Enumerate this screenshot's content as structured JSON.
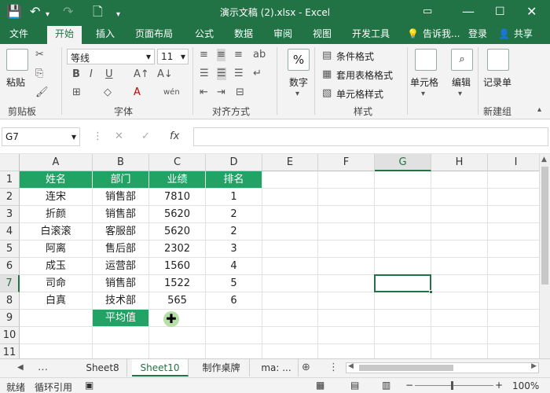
{
  "titlebar": {
    "title": "演示文稿 (2).xlsx - Excel"
  },
  "tabs": {
    "file": "文件",
    "home": "开始",
    "insert": "插入",
    "layout": "页面布局",
    "formula": "公式",
    "data": "数据",
    "review": "审阅",
    "view": "视图",
    "developer": "开发工具",
    "tellme": "告诉我...",
    "login": "登录",
    "share": "共享"
  },
  "ribbon": {
    "paste": "粘贴",
    "clipboard": "剪贴板",
    "font_name": "等线",
    "font_size": "11",
    "font_group": "字体",
    "align_group": "对齐方式",
    "number": "数字",
    "cond_format": "条件格式",
    "table_format": "套用表格格式",
    "cell_style": "单元格样式",
    "style_group": "样式",
    "cells": "单元格",
    "edit": "编辑",
    "record": "记录单",
    "new_group": "新建组"
  },
  "formula_bar": {
    "name_box": "G7",
    "fx": "fx",
    "value": ""
  },
  "columns": [
    "A",
    "B",
    "C",
    "D",
    "E",
    "F",
    "G",
    "H",
    "I"
  ],
  "rows": [
    "1",
    "2",
    "3",
    "4",
    "5",
    "6",
    "7",
    "8",
    "9",
    "10",
    "11"
  ],
  "table": {
    "header": [
      "姓名",
      "部门",
      "业绩",
      "排名"
    ],
    "rows": [
      [
        "连宋",
        "销售部",
        "7810",
        "1"
      ],
      [
        "折颜",
        "销售部",
        "5620",
        "2"
      ],
      [
        "白滚滚",
        "客服部",
        "5620",
        "2"
      ],
      [
        "阿离",
        "售后部",
        "2302",
        "3"
      ],
      [
        "成玉",
        "运营部",
        "1560",
        "4"
      ],
      [
        "司命",
        "销售部",
        "1522",
        "5"
      ],
      [
        "白真",
        "技术部",
        "565",
        "6"
      ]
    ],
    "avg_label": "平均值"
  },
  "sheets": {
    "tabs": [
      "Sheet8",
      "Sheet10",
      "制作桌牌",
      "ma: ..."
    ],
    "active": "Sheet10"
  },
  "status": {
    "ready": "就绪",
    "circular": "循环引用",
    "zoom": "100%"
  },
  "colors": {
    "excel_green": "#217346",
    "header_fill": "#21a366"
  }
}
